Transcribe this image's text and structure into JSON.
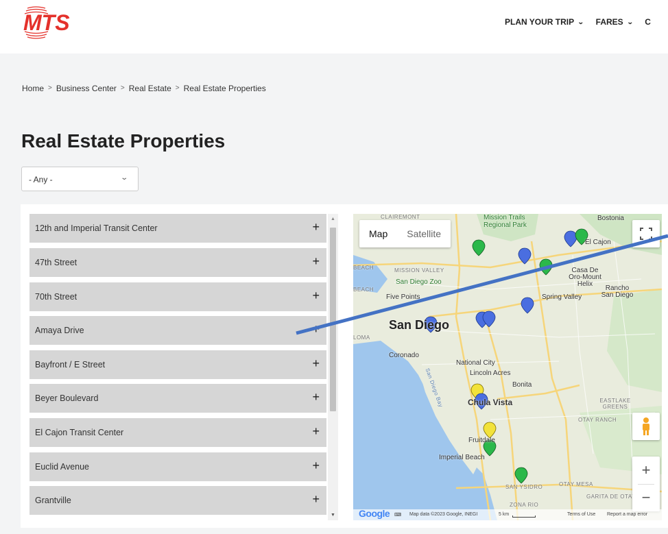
{
  "header": {
    "logo_text": "MTS",
    "nav": [
      {
        "label": "PLAN YOUR TRIP"
      },
      {
        "label": "FARES"
      },
      {
        "label": "C"
      }
    ]
  },
  "breadcrumb": [
    "Home",
    "Business Center",
    "Real Estate",
    "Real Estate Properties"
  ],
  "page_title": "Real Estate Properties",
  "filter": {
    "selected": "- Any -"
  },
  "properties": [
    "12th and Imperial Transit Center",
    "47th Street",
    "70th Street",
    "Amaya Drive",
    "Bayfront / E Street",
    "Beyer Boulevard",
    "El Cajon Transit Center",
    "Euclid Avenue",
    "Grantville"
  ],
  "expand_symbol": "+",
  "map": {
    "type_buttons": {
      "map": "Map",
      "satellite": "Satellite"
    },
    "labels": {
      "san_diego": "San Diego",
      "chula_vista": "Chula Vista",
      "national_city": "National City",
      "lincoln_acres": "Lincoln Acres",
      "bonita": "Bonita",
      "coronado": "Coronado",
      "imperial_beach": "Imperial Beach",
      "fruitdale": "Fruitdale",
      "mission_valley": "MISSION VALLEY",
      "san_diego_zoo": "San Diego Zoo",
      "five_points": "Five Points",
      "spring_valley": "Spring Valley",
      "casa_de_oro": "Casa De Oro-Mount Helix",
      "rancho_san_diego": "Rancho San Diego",
      "el_cajon": "El Cajon",
      "bostonia": "Bostonia",
      "mission_trails": "Mission Trails Regional Park",
      "clairemont": "CLAIREMONT",
      "eastlake": "EASTLAKE GREENS",
      "otay_ranch": "OTAY RANCH",
      "otay_mesa": "OTAY MESA",
      "san_ysidro": "SAN YSIDRO",
      "garita": "GARITA DE OTAY",
      "zona_rio": "ZONA RIO",
      "san_diego_bay": "San Diego Bay",
      "loma": "LOMA",
      "beach": "BEACH",
      "beach2": "BEACH"
    },
    "footer": {
      "google": "Google",
      "data": "Map data ©2023 Google, INEGI",
      "scale": "5 km",
      "terms": "Terms of Use",
      "report": "Report a map error"
    },
    "zoom_in": "+",
    "zoom_out": "−",
    "pin_colors": {
      "blue": "#4a6ee0",
      "green": "#2bb84a",
      "yellow": "#f2e23a"
    }
  }
}
